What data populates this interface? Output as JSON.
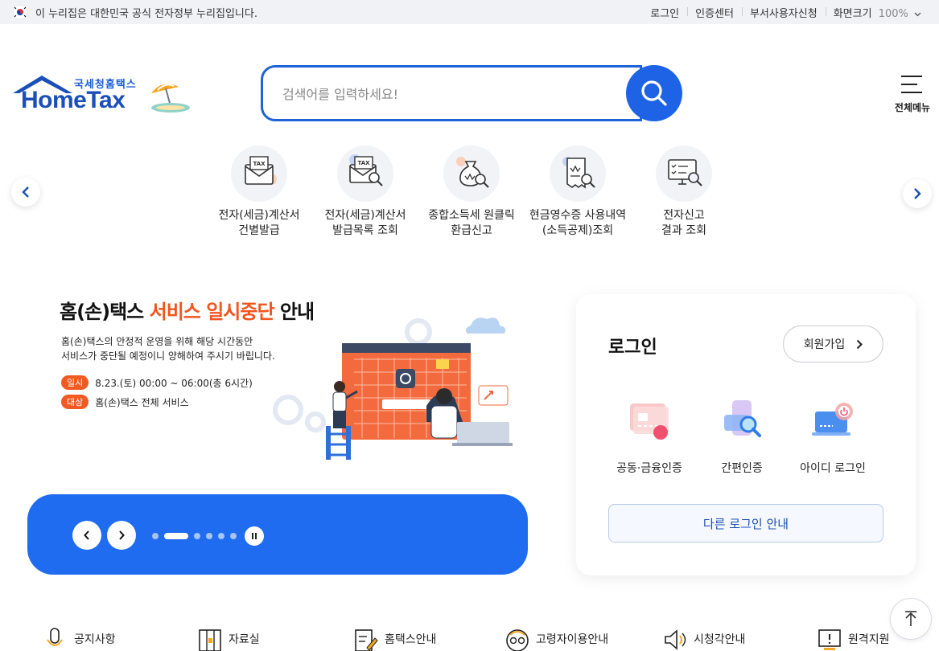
{
  "gov_bar": {
    "notice": "이 누리집은 대한민국 공식 전자정부 누리집입니다.",
    "links": [
      "로그인",
      "인증센터",
      "부서사용자신청",
      "화면크기"
    ],
    "zoom": "100%"
  },
  "logo": {
    "korean": "국세청홈택스",
    "english": "HomeTax"
  },
  "search": {
    "placeholder": "검색어를 입력하세요!"
  },
  "menu": {
    "label": "전체메뉴"
  },
  "quick_services": [
    {
      "line1": "전자(세금)계산서",
      "line2": "건별발급"
    },
    {
      "line1": "전자(세금)계산서",
      "line2": "발급목록 조회"
    },
    {
      "line1": "종합소득세 원클릭",
      "line2": "환급신고"
    },
    {
      "line1": "현금영수증 사용내역",
      "line2": "(소득공제)조회"
    },
    {
      "line1": "전자신고",
      "line2": "결과 조회"
    }
  ],
  "banner": {
    "title_prefix": "홈(손)택스 ",
    "title_highlight": "서비스 일시중단",
    "title_suffix": " 안내",
    "desc_line1": "홈(손)택스의 안정적 운영을 위해 해당 시간동안",
    "desc_line2": "서비스가 중단될 예정이니 양해하여 주시기 바립니다.",
    "date_label": "일시",
    "date_value": "8.23.(토) 00:00 ~ 06:00(총 6시간)",
    "target_label": "대상",
    "target_value": "홈(손)택스 전체 서비스",
    "active_slide": 2,
    "slide_count": 6
  },
  "login": {
    "title": "로그인",
    "join": "회원가입",
    "methods": [
      "공동·금융인증",
      "간편인증",
      "아이디 로그인"
    ],
    "other": "다른 로그인 안내"
  },
  "bottom_links": [
    "공지사항",
    "자료실",
    "홈택스안내",
    "고령자이용안내",
    "시청각안내",
    "원격지원"
  ],
  "colors": {
    "primary": "#1e63e6",
    "accent": "#f2541e",
    "banner_bar": "#1f6cf0"
  }
}
